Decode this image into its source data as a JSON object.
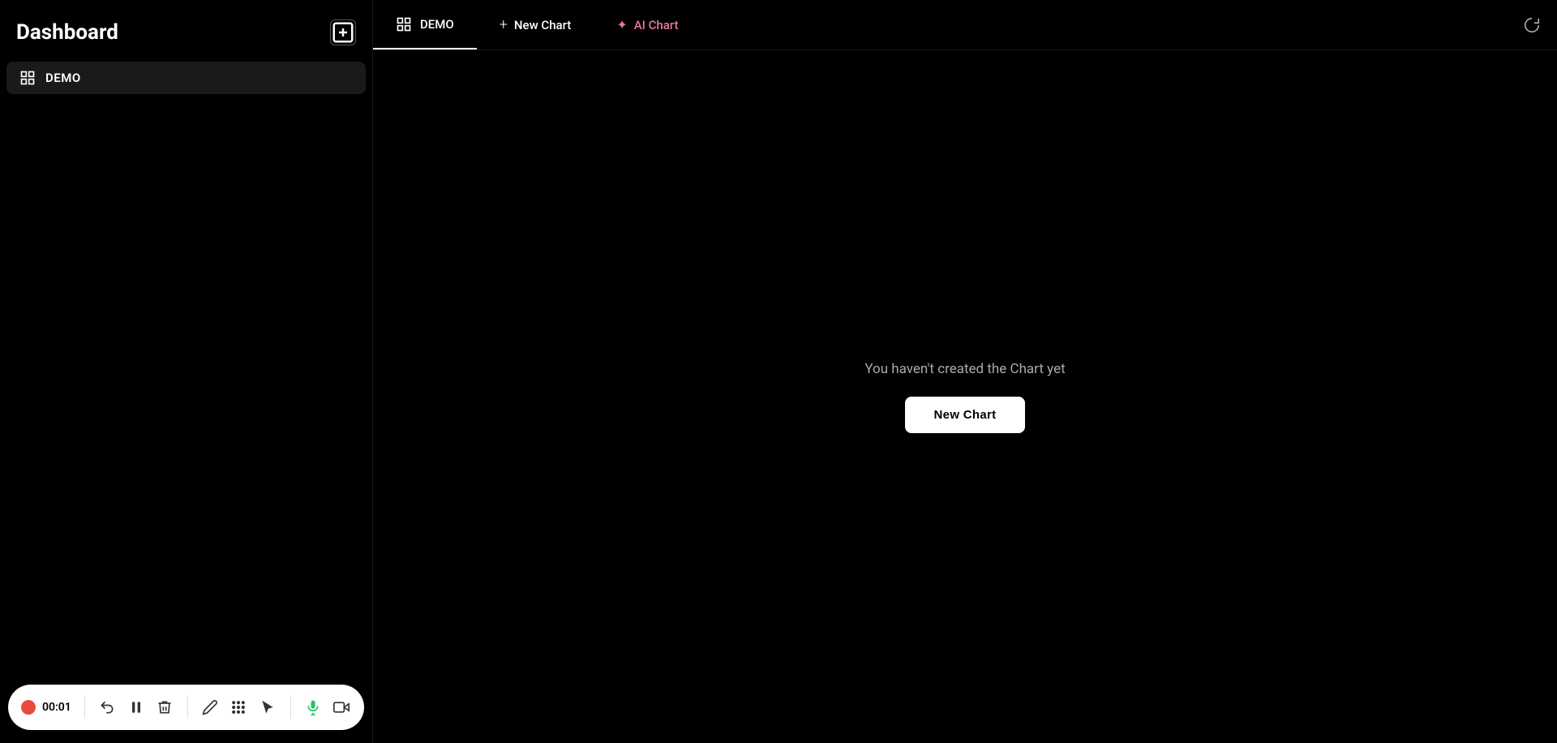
{
  "sidebar": {
    "title": "Dashboard",
    "add_button_label": "+",
    "items": [
      {
        "id": "demo",
        "label": "DEMO",
        "active": true
      }
    ]
  },
  "top_nav": {
    "tabs": [
      {
        "id": "demo",
        "label": "DEMO",
        "active": true,
        "has_icon": true
      }
    ],
    "new_chart_label": "New Chart",
    "ai_chart_label": "AI Chart",
    "ai_chart_icon": "✦"
  },
  "main": {
    "empty_state_text": "You haven't created the Chart yet",
    "new_chart_button_label": "New Chart"
  },
  "toolbar": {
    "time": "00:01",
    "record_dot_color": "#e74c3c"
  }
}
